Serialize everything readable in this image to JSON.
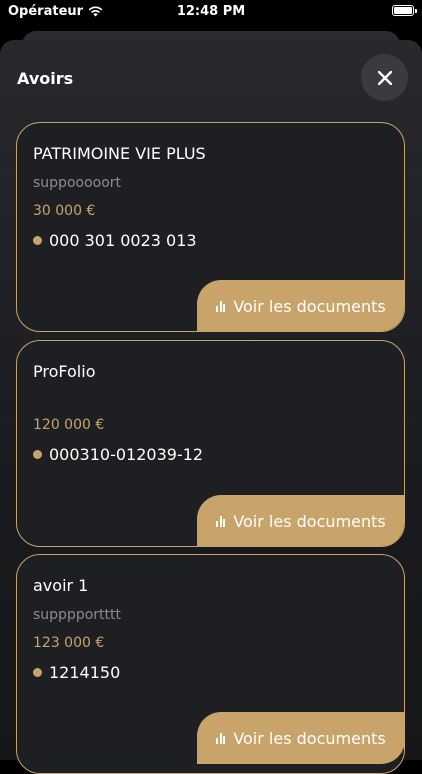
{
  "status": {
    "carrier": "Opérateur",
    "time": "12:48 PM"
  },
  "sheet": {
    "title": "Avoirs"
  },
  "cards": [
    {
      "name": "PATRIMOINE VIE PLUS",
      "description": "suppooooort",
      "amount": "30 000 €",
      "account": "000 301 0023 013",
      "button_label": "Voir les documents"
    },
    {
      "name": "ProFolio",
      "description": "",
      "amount": "120 000 €",
      "account": "000310-012039-12",
      "button_label": "Voir les documents"
    },
    {
      "name": "avoir 1",
      "description": "supppportttt",
      "amount": "123 000 €",
      "account": "1214150",
      "button_label": "Voir les documents"
    }
  ],
  "colors": {
    "accent": "#c9a46a",
    "card_bg": "#1e1f22",
    "sheet_bg": "#28292d"
  }
}
